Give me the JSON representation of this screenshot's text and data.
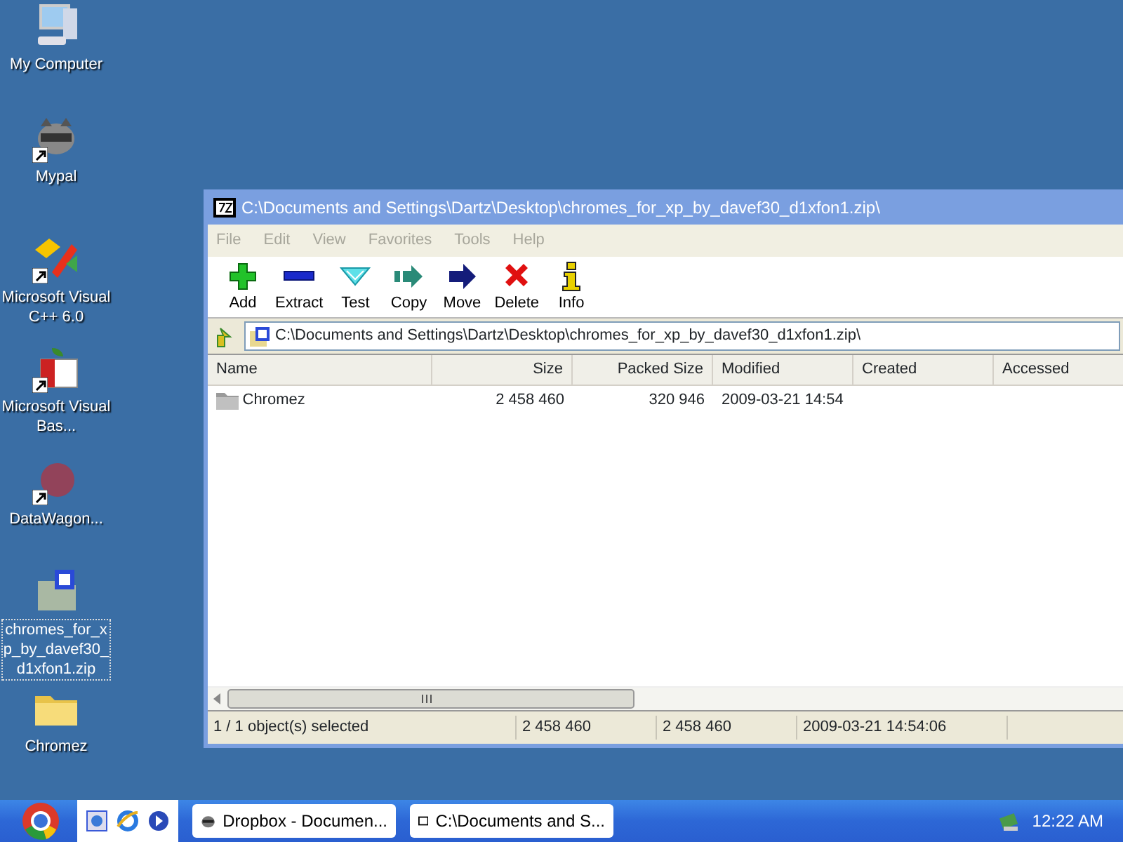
{
  "desktop_icons": [
    {
      "label": "My Computer",
      "shortcut": false,
      "selected": false
    },
    {
      "label": "Mypal",
      "shortcut": true,
      "selected": false
    },
    {
      "label": "Microsoft Visual C++ 6.0",
      "shortcut": true,
      "selected": false
    },
    {
      "label": "Microsoft Visual Bas...",
      "shortcut": true,
      "selected": false
    },
    {
      "label": "DataWagon...",
      "shortcut": true,
      "selected": false
    },
    {
      "label": "chromes_for_xp_by_davef30_d1xfon1.zip",
      "shortcut": false,
      "selected": true
    },
    {
      "label": "Chromez",
      "shortcut": false,
      "selected": false
    }
  ],
  "window": {
    "title": "C:\\Documents and Settings\\Dartz\\Desktop\\chromes_for_xp_by_davef30_d1xfon1.zip\\",
    "menu": [
      {
        "label": "File",
        "disabled": true
      },
      {
        "label": "Edit",
        "disabled": true
      },
      {
        "label": "View",
        "disabled": true
      },
      {
        "label": "Favorites",
        "disabled": true
      },
      {
        "label": "Tools",
        "disabled": true
      },
      {
        "label": "Help",
        "disabled": true
      }
    ],
    "toolbar": [
      "Add",
      "Extract",
      "Test",
      "Copy",
      "Move",
      "Delete",
      "Info"
    ],
    "address": "C:\\Documents and Settings\\Dartz\\Desktop\\chromes_for_xp_by_davef30_d1xfon1.zip\\",
    "columns": [
      "Name",
      "Size",
      "Packed Size",
      "Modified",
      "Created",
      "Accessed"
    ],
    "rows": [
      {
        "name": "Chromez",
        "size": "2 458 460",
        "packed_size": "320 946",
        "modified": "2009-03-21 14:54",
        "selected": false
      }
    ],
    "status_bar": [
      "1 / 1 object(s) selected",
      "2 458 460",
      "2 458 460",
      "2009-03-21 14:54:06"
    ]
  },
  "taskbar": {
    "tasks": [
      "Dropbox - Documen...",
      "C:\\Documents and S..."
    ],
    "clock": "12:22 AM"
  }
}
